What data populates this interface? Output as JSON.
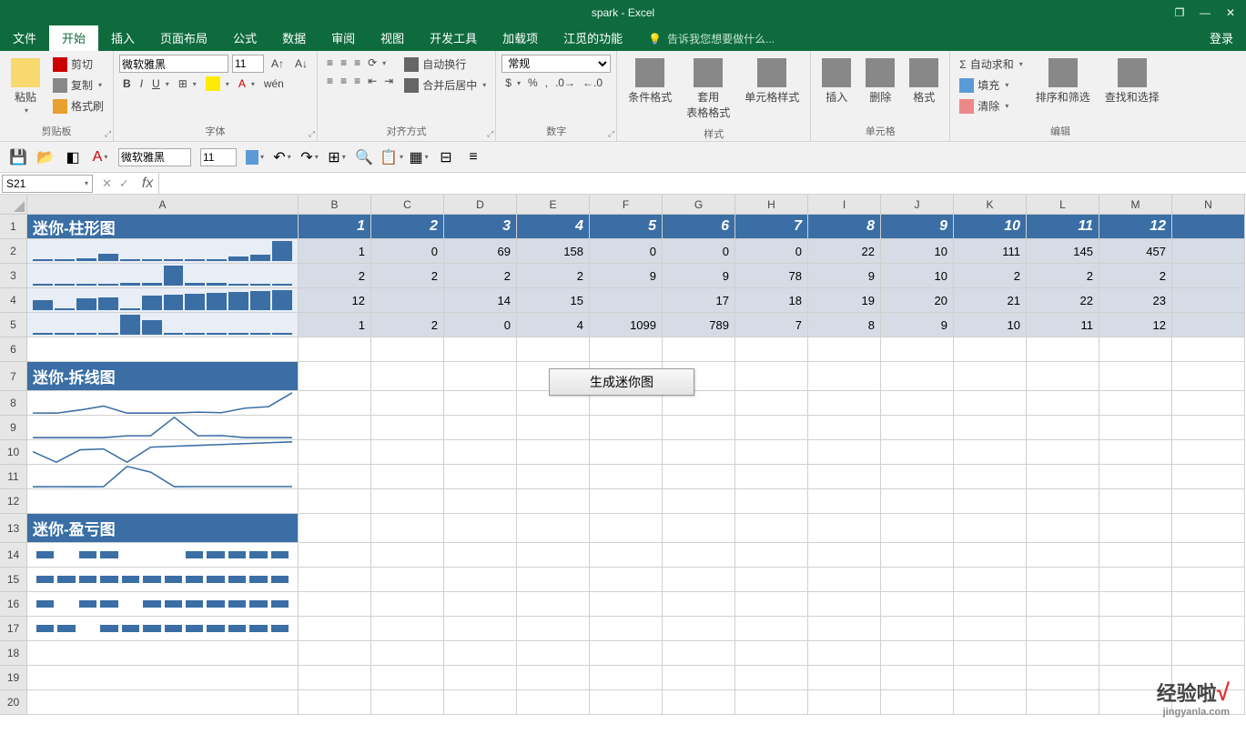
{
  "title": "spark - Excel",
  "window_controls": {
    "restore": "❐",
    "minimize": "—",
    "close": "✕"
  },
  "tabs": {
    "file": "文件",
    "home": "开始",
    "insert": "插入",
    "layout": "页面布局",
    "formula": "公式",
    "data": "数据",
    "review": "审阅",
    "view": "视图",
    "dev": "开发工具",
    "addin": "加载项",
    "custom": "江觅的功能",
    "tell": "告诉我您想要做什么...",
    "login": "登录"
  },
  "ribbon": {
    "clipboard": {
      "paste": "粘贴",
      "cut": "剪切",
      "copy": "复制",
      "painter": "格式刷",
      "label": "剪贴板"
    },
    "font": {
      "name": "微软雅黑",
      "size": "11",
      "label": "字体",
      "pinyin": "wén"
    },
    "align": {
      "wrap": "自动换行",
      "merge": "合并后居中",
      "label": "对齐方式"
    },
    "number": {
      "format": "常规",
      "label": "数字"
    },
    "styles": {
      "cond": "条件格式",
      "table": "套用\n表格格式",
      "cell": "单元格样式",
      "label": "样式"
    },
    "cells": {
      "insert": "插入",
      "delete": "删除",
      "format": "格式",
      "label": "单元格"
    },
    "editing": {
      "sum": "自动求和",
      "fill": "填充",
      "clear": "清除",
      "sort": "排序和筛选",
      "find": "查找和选择",
      "label": "编辑"
    }
  },
  "qat": {
    "font": "微软雅黑",
    "size": "11"
  },
  "namebox": "S21",
  "columns": [
    "A",
    "B",
    "C",
    "D",
    "E",
    "F",
    "G",
    "H",
    "I",
    "J",
    "K",
    "L",
    "M",
    "N"
  ],
  "col_widths": {
    "A": 298,
    "other": 80
  },
  "rows": [
    "1",
    "2",
    "3",
    "4",
    "5",
    "6",
    "7",
    "8",
    "9",
    "10",
    "11",
    "12",
    "13",
    "14",
    "15",
    "16",
    "17",
    "18",
    "19",
    "20"
  ],
  "headers": {
    "bar": "迷你-柱形图",
    "line": "迷你-拆线图",
    "winloss": "迷你-盈亏图",
    "nums": [
      "1",
      "2",
      "3",
      "4",
      "5",
      "6",
      "7",
      "8",
      "9",
      "10",
      "11",
      "12"
    ]
  },
  "chart_data": [
    {
      "type": "bar",
      "values": [
        1,
        0,
        69,
        158,
        0,
        0,
        0,
        22,
        10,
        111,
        145,
        457
      ]
    },
    {
      "type": "bar",
      "values": [
        2,
        2,
        2,
        2,
        9,
        9,
        78,
        9,
        10,
        2,
        2,
        2
      ]
    },
    {
      "type": "bar",
      "values": [
        12,
        0,
        14,
        15,
        0,
        17,
        18,
        19,
        20,
        21,
        22,
        23
      ]
    },
    {
      "type": "bar",
      "values": [
        1,
        2,
        0,
        4,
        1099,
        789,
        7,
        8,
        9,
        10,
        11,
        12
      ]
    }
  ],
  "data_rows": [
    [
      "1",
      "0",
      "69",
      "158",
      "0",
      "0",
      "0",
      "22",
      "10",
      "111",
      "145",
      "457"
    ],
    [
      "2",
      "2",
      "2",
      "2",
      "9",
      "9",
      "78",
      "9",
      "10",
      "2",
      "2",
      "2"
    ],
    [
      "12",
      "",
      "14",
      "15",
      "",
      "17",
      "18",
      "19",
      "20",
      "21",
      "22",
      "23"
    ],
    [
      "1",
      "2",
      "0",
      "4",
      "1099",
      "789",
      "7",
      "8",
      "9",
      "10",
      "11",
      "12"
    ]
  ],
  "button": "生成迷你图",
  "watermark": {
    "text": "经验啦",
    "url": "jingyanla.com"
  }
}
